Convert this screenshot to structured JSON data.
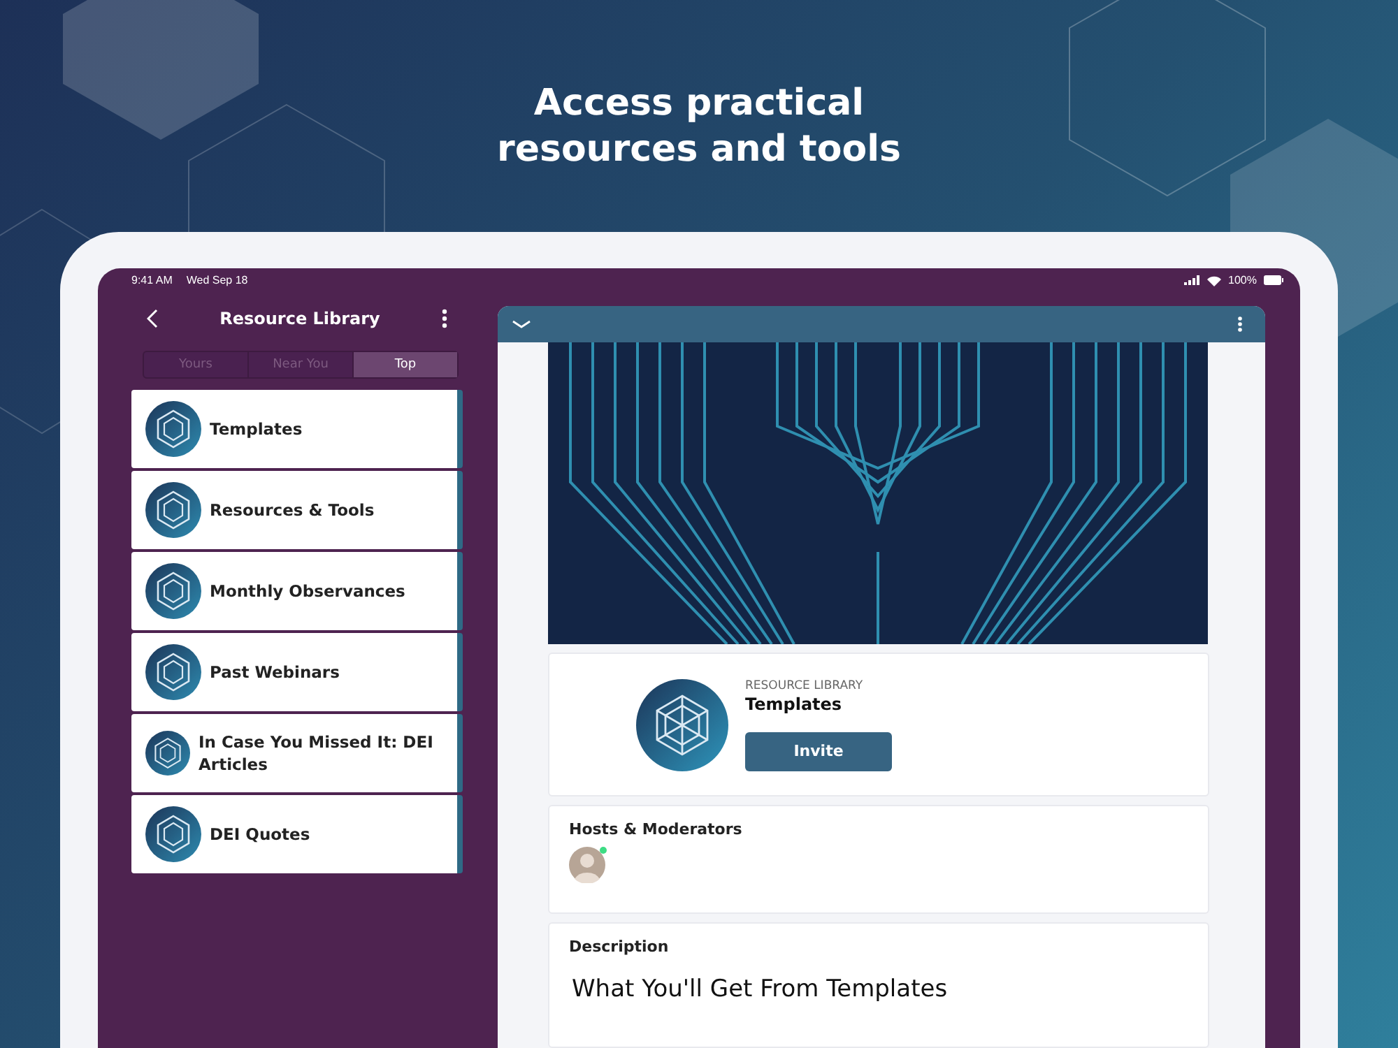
{
  "headline": [
    "Access practical",
    "resources and tools"
  ],
  "status_bar": {
    "time": "9:41 AM",
    "date": "Wed Sep 18",
    "battery": "100%"
  },
  "sidebar": {
    "title": "Resource Library",
    "tabs": [
      {
        "label": "Yours",
        "selected": false
      },
      {
        "label": "Near You",
        "selected": false
      },
      {
        "label": "Top",
        "selected": true
      }
    ],
    "items": [
      {
        "label": "Templates"
      },
      {
        "label": "Resources & Tools"
      },
      {
        "label": "Monthly Observances"
      },
      {
        "label": "Past Webinars"
      },
      {
        "label": "In Case You Missed It: DEI Articles"
      },
      {
        "label": "DEI Quotes"
      }
    ]
  },
  "detail": {
    "category": "RESOURCE LIBRARY",
    "title": "Templates",
    "invite_button": "Invite",
    "hosts": {
      "heading": "Hosts & Moderators",
      "people": [
        {
          "online": true
        }
      ]
    },
    "description": {
      "heading": "Description",
      "title": "What You'll Get From Templates"
    }
  }
}
